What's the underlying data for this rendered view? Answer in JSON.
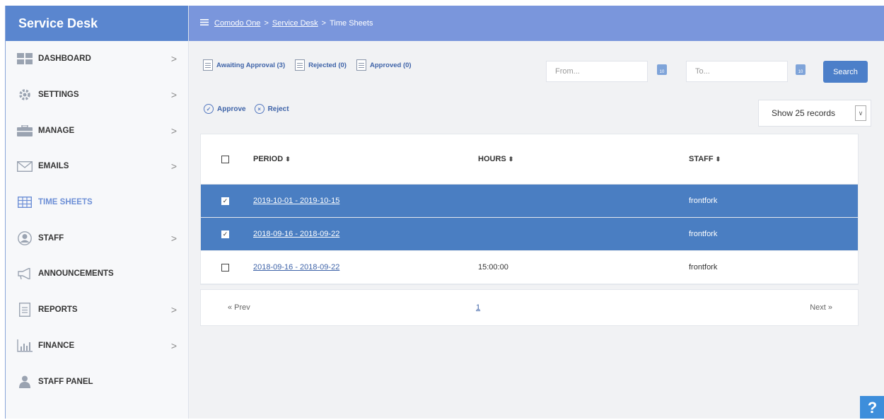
{
  "sidebar": {
    "title": "Service Desk",
    "items": [
      {
        "label": "DASHBOARD",
        "icon": "dashboard-icon",
        "chevron": true,
        "active": false
      },
      {
        "label": "SETTINGS",
        "icon": "gear-icon",
        "chevron": true,
        "active": false
      },
      {
        "label": "MANAGE",
        "icon": "briefcase-icon",
        "chevron": true,
        "active": false
      },
      {
        "label": "EMAILS",
        "icon": "envelope-icon",
        "chevron": true,
        "active": false
      },
      {
        "label": "TIME SHEETS",
        "icon": "table-icon",
        "chevron": false,
        "active": true
      },
      {
        "label": "STAFF",
        "icon": "user-circle-icon",
        "chevron": true,
        "active": false
      },
      {
        "label": "ANNOUNCEMENTS",
        "icon": "megaphone-icon",
        "chevron": false,
        "active": false
      },
      {
        "label": "REPORTS",
        "icon": "document-icon",
        "chevron": true,
        "active": false
      },
      {
        "label": "FINANCE",
        "icon": "bar-chart-icon",
        "chevron": true,
        "active": false
      },
      {
        "label": "STAFF PANEL",
        "icon": "person-icon",
        "chevron": false,
        "active": false
      }
    ],
    "chevron_glyph": ">"
  },
  "breadcrumb": {
    "items": [
      "Comodo One",
      "Service Desk",
      "Time Sheets"
    ],
    "separator": ">"
  },
  "filters": [
    {
      "label": "Awaiting Approval (3)"
    },
    {
      "label": "Rejected (0)"
    },
    {
      "label": "Approved (0)"
    }
  ],
  "date_range": {
    "from_placeholder": "From...",
    "to_placeholder": "To..."
  },
  "search_label": "Search",
  "actions": {
    "approve": "Approve",
    "reject": "Reject"
  },
  "show_records": "Show 25 records",
  "table": {
    "headers": {
      "period": "PERIOD",
      "hours": "HOURS",
      "staff": "STAFF"
    },
    "sort_glyph": "⬍",
    "rows": [
      {
        "period": "2019-10-01 - 2019-10-15",
        "hours": "",
        "staff": "frontfork",
        "selected": true
      },
      {
        "period": "2018-09-16 - 2018-09-22",
        "hours": "",
        "staff": "frontfork",
        "selected": true
      },
      {
        "period": "2018-09-16 - 2018-09-22",
        "hours": "15:00:00",
        "staff": "frontfork",
        "selected": false
      }
    ]
  },
  "pagination": {
    "prev": "« Prev",
    "page": "1",
    "next": "Next »"
  },
  "help_label": "?",
  "colors": {
    "brand": "#5a86cf",
    "topbar": "#7a96dc",
    "selected_row": "#4a7ec2",
    "link": "#3e63a8"
  }
}
